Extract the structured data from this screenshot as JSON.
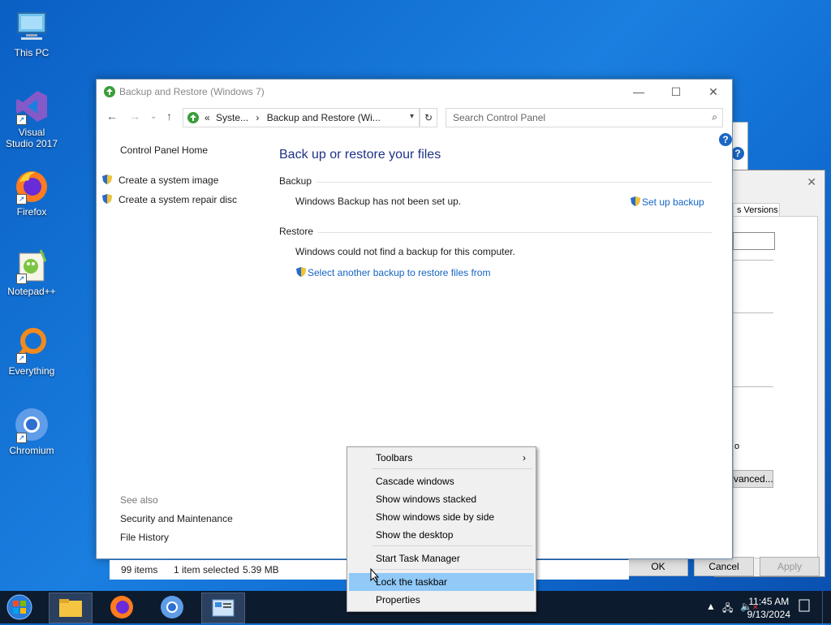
{
  "desktop_icons": [
    {
      "label": "This PC",
      "icon": "this-pc-icon"
    },
    {
      "label": "Visual Studio 2017",
      "icon": "visual-studio-icon"
    },
    {
      "label": "Firefox",
      "icon": "firefox-icon"
    },
    {
      "label": "Notepad++",
      "icon": "notepadpp-icon"
    },
    {
      "label": "Everything",
      "icon": "everything-icon"
    },
    {
      "label": "Chromium",
      "icon": "chromium-icon"
    }
  ],
  "window": {
    "title": "Backup and Restore (Windows 7)",
    "address": {
      "prefix": "«",
      "crumb1": "Syste...",
      "crumb2": "Backup and Restore (Wi..."
    },
    "search_placeholder": "Search Control Panel",
    "left_pane": {
      "home": "Control Panel Home",
      "tasks": [
        "Create a system image",
        "Create a system repair disc"
      ],
      "see_also_title": "See also",
      "see_also": [
        "Security and Maintenance",
        "File History"
      ]
    },
    "heading": "Back up or restore your files",
    "backup": {
      "label": "Backup",
      "message": "Windows Backup has not been set up.",
      "action": "Set up backup"
    },
    "restore": {
      "label": "Restore",
      "message": "Windows could not find a backup for this computer.",
      "action": "Select another backup to restore files from"
    },
    "help": "?"
  },
  "statusbar": {
    "items": "99 items",
    "selected": "1 item selected",
    "size": "5.39 MB"
  },
  "props_dialog": {
    "tab_partial": "s Versions",
    "partial_text": "o",
    "advanced_partial": "vanced...",
    "ok": "OK",
    "cancel": "Cancel",
    "apply": "Apply"
  },
  "context_menu": [
    {
      "label": "Toolbars",
      "submenu": true
    },
    {
      "label": "Cascade windows"
    },
    {
      "label": "Show windows stacked"
    },
    {
      "label": "Show windows side by side"
    },
    {
      "label": "Show the desktop"
    },
    {
      "label": "Start Task Manager"
    },
    {
      "label": "Lock the taskbar",
      "highlighted": true
    },
    {
      "label": "Properties"
    }
  ],
  "taskbar": {
    "clock_time": "11:45 AM",
    "clock_date": "9/13/2024"
  },
  "colors": {
    "link": "#1465c3",
    "heading": "#1e3287",
    "taskbar": "#0d1b2e",
    "menu_highlight": "#91c9f7"
  }
}
